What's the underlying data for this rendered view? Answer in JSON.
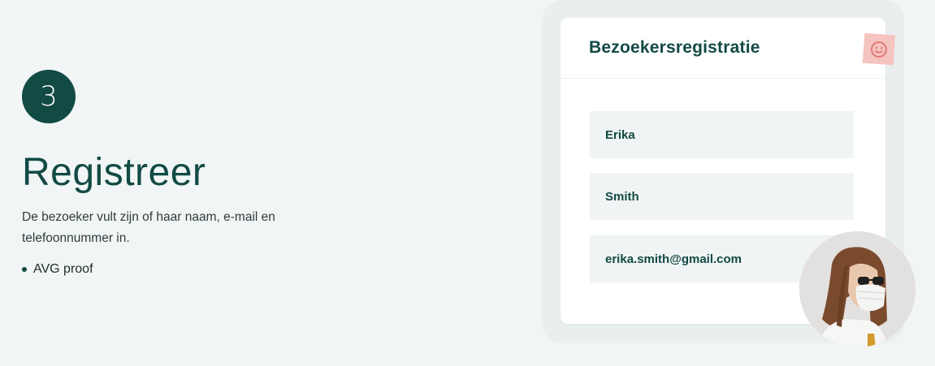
{
  "step": {
    "number": "3"
  },
  "section": {
    "title": "Registreer",
    "description": "De bezoeker vult zijn of haar naam, e-mail en telefoonnummer in.",
    "bullets": [
      "AVG proof"
    ]
  },
  "form": {
    "title": "Bezoekersregistratie",
    "fields": [
      {
        "value": "Erika"
      },
      {
        "value": "Smith"
      },
      {
        "value": "erika.smith@gmail.com"
      }
    ]
  },
  "icons": {
    "sticker": "smiley-icon"
  },
  "colors": {
    "primary": "#124a44",
    "background": "#f1f5f5",
    "field_background": "#f0f4f4",
    "sticker": "#f6c4c0"
  }
}
